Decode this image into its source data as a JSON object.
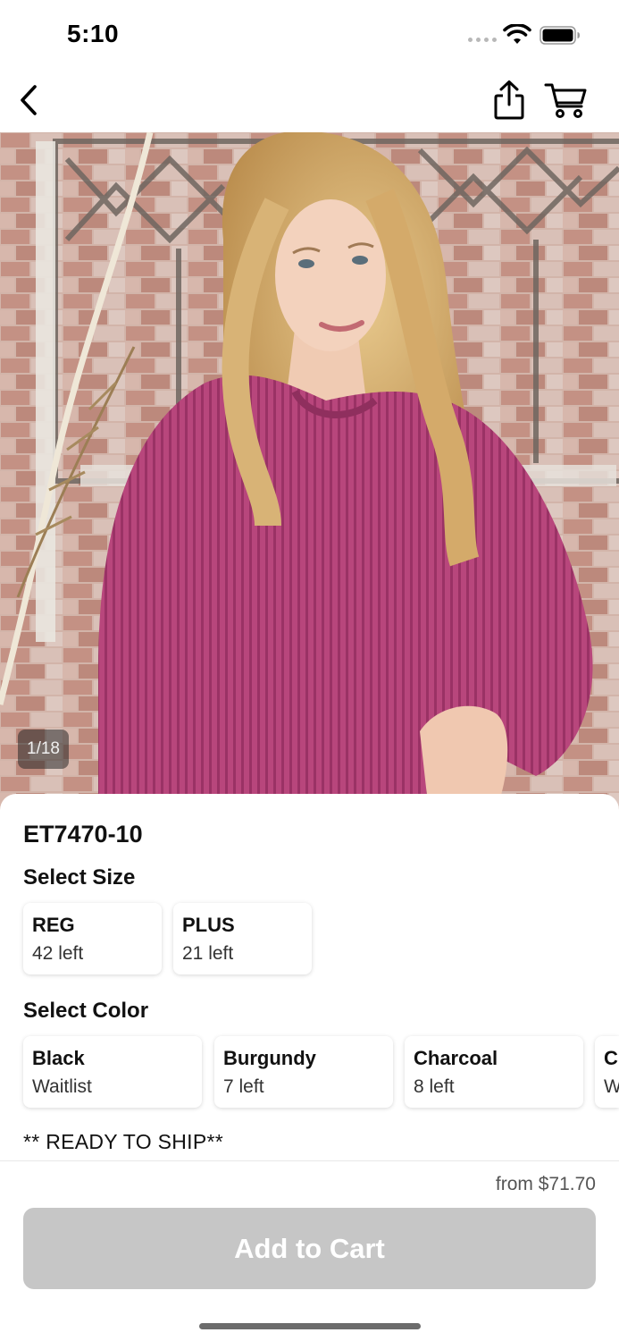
{
  "status_bar": {
    "time": "5:10"
  },
  "nav": {
    "back_icon": "chevron-left-icon",
    "share_icon": "share-icon",
    "cart_icon": "cart-icon"
  },
  "gallery": {
    "counter": "1/18"
  },
  "product": {
    "sku": "ET7470-10",
    "size_title": "Select Size",
    "sizes": [
      {
        "name": "REG",
        "stock": "42 left"
      },
      {
        "name": "PLUS",
        "stock": "21 left"
      }
    ],
    "color_title": "Select Color",
    "colors": [
      {
        "name": "Black",
        "stock": "Waitlist"
      },
      {
        "name": "Burgundy",
        "stock": "7 left"
      },
      {
        "name": "Charcoal",
        "stock": "8 left"
      },
      {
        "name": "C",
        "stock": "W"
      }
    ],
    "note": "** READY TO SHIP**"
  },
  "purchase": {
    "price": "from $71.70",
    "add_to_cart_label": "Add to Cart"
  },
  "colors": {
    "sweater": "#b8467c",
    "button_disabled": "#c6c6c6"
  }
}
